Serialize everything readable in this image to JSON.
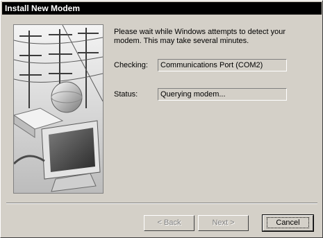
{
  "window": {
    "title": "Install New Modem"
  },
  "message": "Please wait while Windows attempts to detect your\nmodem.  This may take several minutes.",
  "checking": {
    "label": "Checking:",
    "value": "Communications Port (COM2)"
  },
  "status": {
    "label": "Status:",
    "value": "Querying modem..."
  },
  "buttons": {
    "back": "< Back",
    "next": "Next >",
    "cancel": "Cancel"
  }
}
